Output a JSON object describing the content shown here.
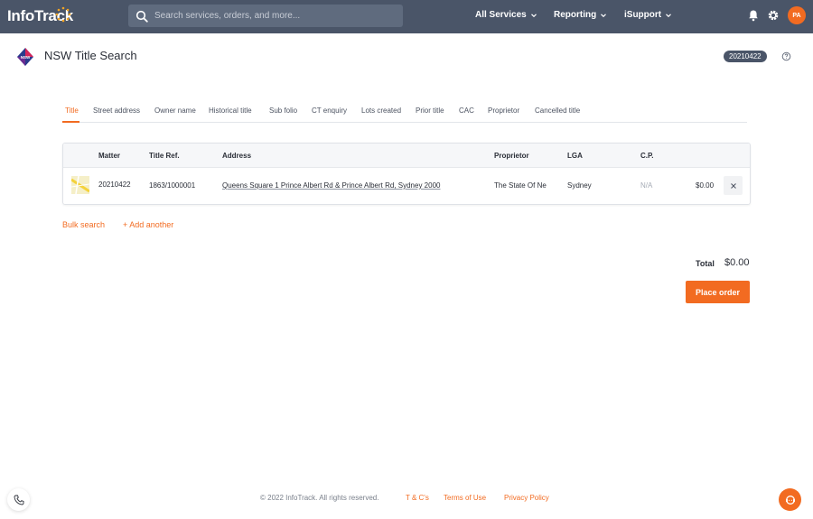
{
  "app": {
    "logo_text": "InfoTrack",
    "search_placeholder": "Search services, orders, and more...",
    "nav": [
      {
        "label": "All Services"
      },
      {
        "label": "Reporting"
      },
      {
        "label": "iSupport"
      }
    ],
    "avatar_initials": "PA"
  },
  "page": {
    "title": "NSW Title Search",
    "logo_text": "NSW",
    "matter_badge": "20210422"
  },
  "tabs": [
    {
      "label": "Title",
      "active": true
    },
    {
      "label": "Street address"
    },
    {
      "label": "Owner name"
    },
    {
      "label": "Historical title"
    },
    {
      "label": "Sub folio"
    },
    {
      "label": "CT enquiry"
    },
    {
      "label": "Lots created"
    },
    {
      "label": "Prior title"
    },
    {
      "label": "CAC"
    },
    {
      "label": "Proprietor"
    },
    {
      "label": "Cancelled title"
    }
  ],
  "table": {
    "columns": [
      "Matter",
      "Title Ref.",
      "Address",
      "Proprietor",
      "LGA",
      "C.P."
    ],
    "rows": [
      {
        "matter": "20210422",
        "title_ref": "1863/1000001",
        "address": "Queens Square 1 Prince Albert Rd & Prince Albert Rd, Sydney 2000",
        "proprietor": "The State Of Ne",
        "lga": "Sydney",
        "cp": "N/A",
        "price": "$0.00"
      }
    ]
  },
  "actions": {
    "bulk_search": "Bulk search",
    "add_another": "+ Add another"
  },
  "summary": {
    "total_label": "Total",
    "total_value": "$0.00",
    "place_order": "Place order"
  },
  "footer": {
    "copyright": "© 2022 InfoTrack. All rights reserved.",
    "links": [
      "T & C's",
      "Terms of Use",
      "Privacy Policy"
    ]
  },
  "colors": {
    "accent": "#f26b21",
    "topbar": "#4a5568"
  }
}
